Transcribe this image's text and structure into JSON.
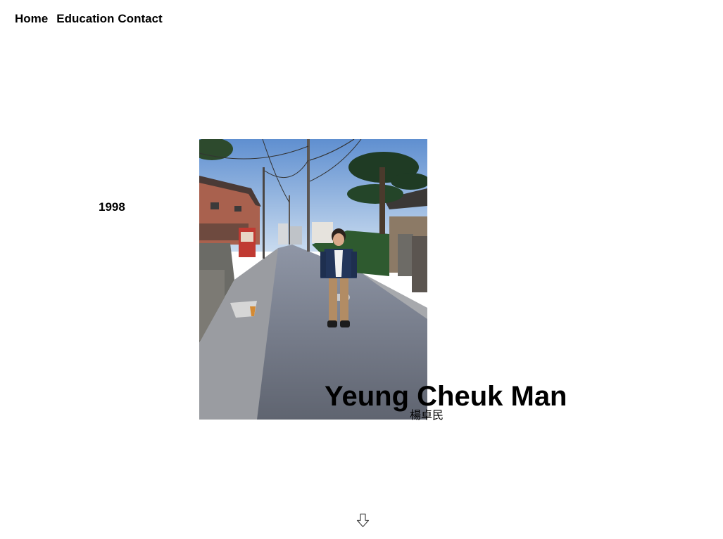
{
  "nav": {
    "items": [
      {
        "label": "Home"
      },
      {
        "label": "Education"
      },
      {
        "label": "Contact"
      }
    ]
  },
  "hero": {
    "year": "1998",
    "name": "Yeung Cheuk Man",
    "name_chinese": "楊卓民",
    "photo_icon": "portrait-photo",
    "scroll_icon": "arrow-down-outline-icon"
  }
}
